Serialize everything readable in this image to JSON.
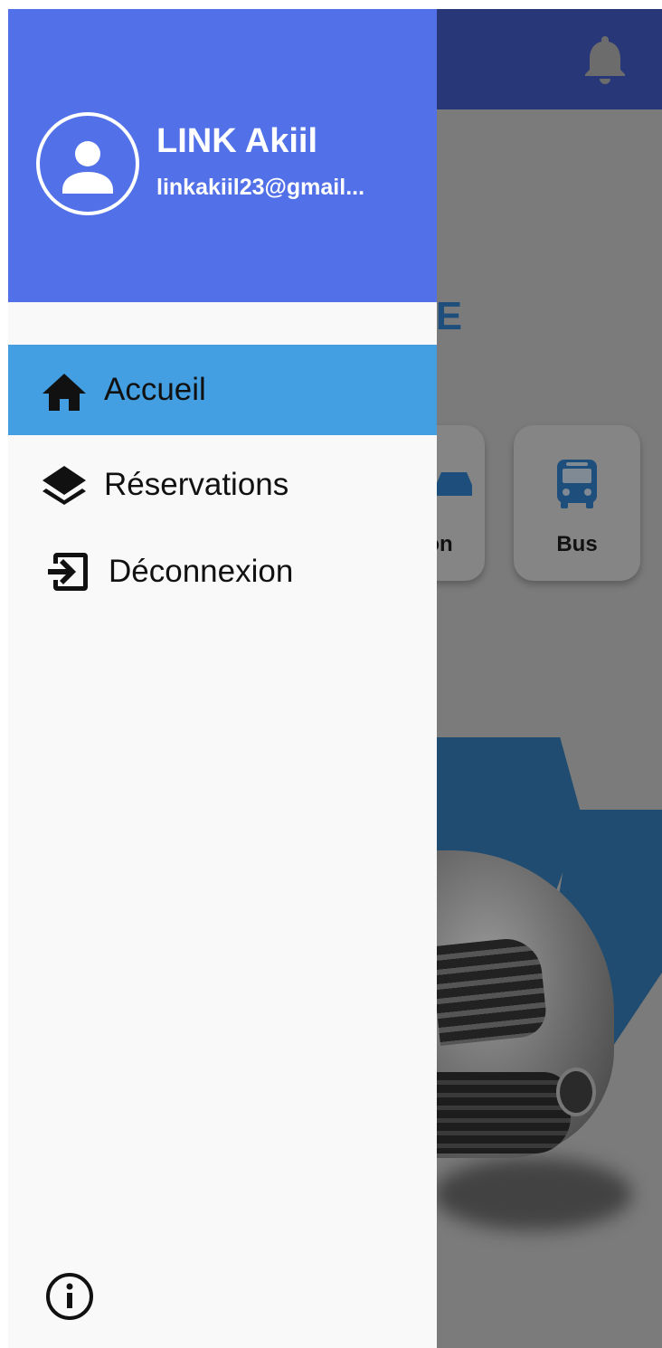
{
  "background": {
    "title_partial": "RE",
    "cards": [
      {
        "label": "on",
        "icon": "car-icon"
      },
      {
        "label": "Bus",
        "icon": "bus-icon"
      }
    ],
    "notification_icon": "bell-icon"
  },
  "drawer": {
    "user": {
      "name": "LINK Akiil",
      "email": "linkakiil23@gmail...",
      "avatar_icon": "person-icon"
    },
    "items": [
      {
        "label": "Accueil",
        "icon": "home-icon",
        "active": true
      },
      {
        "label": "Réservations",
        "icon": "layers-icon",
        "active": false
      },
      {
        "label": "Déconnexion",
        "icon": "logout-icon",
        "active": false
      }
    ],
    "footer_icon": "info-icon"
  },
  "colors": {
    "header": "#5271e9",
    "active_item": "#439fe1",
    "drawer_bg": "#f9f9f9",
    "bg_appbar": "#273777"
  }
}
